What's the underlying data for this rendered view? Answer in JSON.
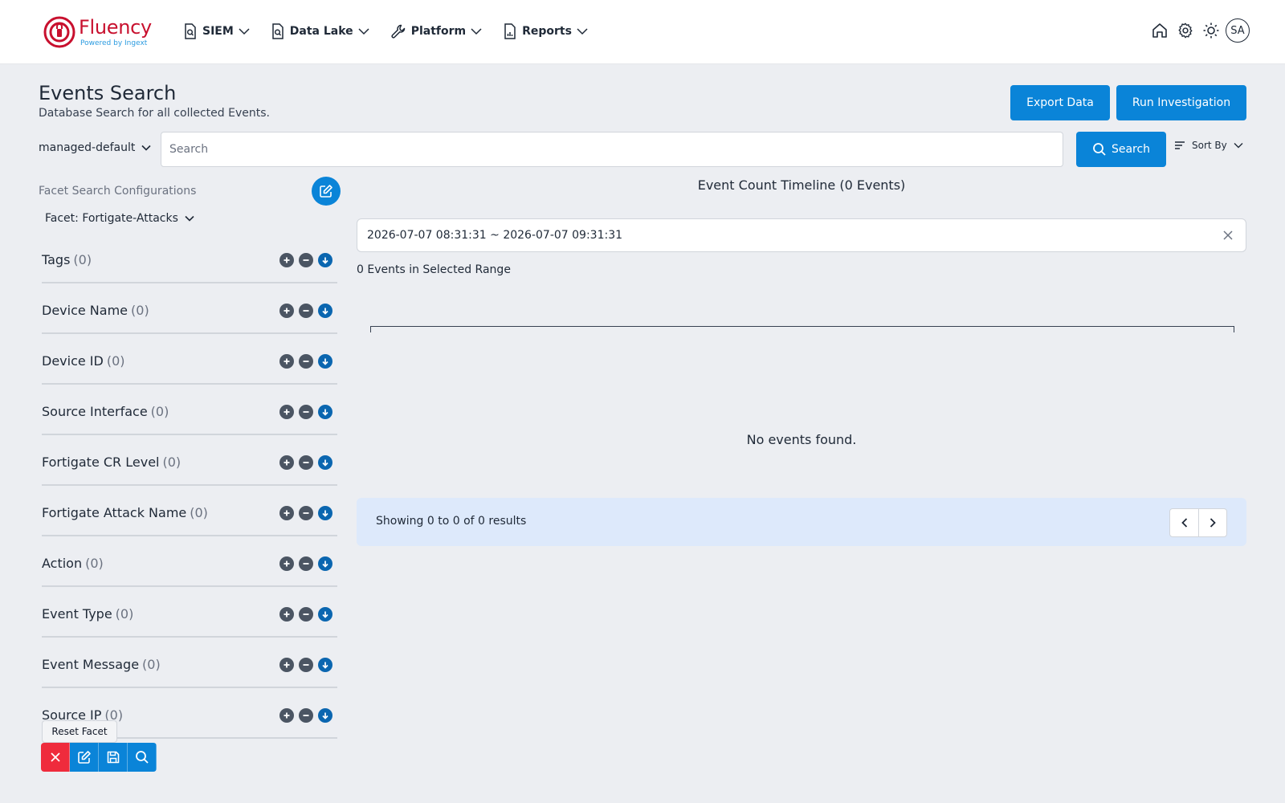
{
  "brand": {
    "name": "Fluency",
    "tagline": "Powered by Ingext",
    "colors": {
      "primary": "#c8102e",
      "accent": "#2b9be0"
    }
  },
  "nav": {
    "items": [
      {
        "label": "SIEM",
        "icon": "search-document-icon"
      },
      {
        "label": "Data Lake",
        "icon": "search-document-icon"
      },
      {
        "label": "Platform",
        "icon": "wrench-icon"
      },
      {
        "label": "Reports",
        "icon": "report-chart-icon"
      }
    ],
    "right_icons": [
      "home-icon",
      "gear-icon",
      "sun-icon"
    ],
    "avatar_initials": "SA"
  },
  "header": {
    "title": "Events Search",
    "subtitle": "Database Search for all collected Events.",
    "export_label": "Export Data",
    "investigation_label": "Run Investigation"
  },
  "search": {
    "database": "managed-default",
    "placeholder": "Search",
    "value": "",
    "button_label": "Search",
    "sort_label": "Sort By"
  },
  "facets": {
    "config_label": "Facet Search Configurations",
    "selected": "Facet: Fortigate-Attacks",
    "items": [
      {
        "name": "Tags",
        "count": "(0)"
      },
      {
        "name": "Device Name",
        "count": "(0)"
      },
      {
        "name": "Device ID",
        "count": "(0)"
      },
      {
        "name": "Source Interface",
        "count": "(0)"
      },
      {
        "name": "Fortigate CR Level",
        "count": "(0)"
      },
      {
        "name": "Fortigate Attack Name",
        "count": "(0)"
      },
      {
        "name": "Action",
        "count": "(0)"
      },
      {
        "name": "Event Type",
        "count": "(0)"
      },
      {
        "name": "Event Message",
        "count": "(0)"
      },
      {
        "name": "Source IP",
        "count": "(0)"
      }
    ],
    "tooltip": "Reset Facet"
  },
  "timeline": {
    "title": "Event Count Timeline (0 Events)",
    "range": "2026-07-07 08:31:31 ~ 2026-07-07 09:31:31",
    "range_count": "0 Events in Selected Range",
    "empty_message": "No events found."
  },
  "pagination": {
    "summary": "Showing 0 to 0 of 0 results"
  }
}
